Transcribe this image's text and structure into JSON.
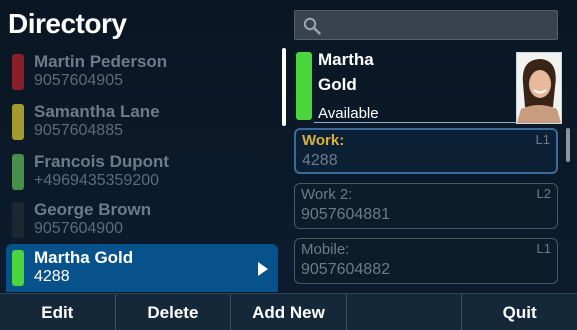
{
  "header": {
    "title": "Directory",
    "search_placeholder": ""
  },
  "contacts": [
    {
      "name": "Martin Pederson",
      "number": "9057604905",
      "status_color": "#8a1f2a"
    },
    {
      "name": "Samantha Lane",
      "number": "9057604885",
      "status_color": "#a29a2b"
    },
    {
      "name": "Francois Dupont",
      "number": "+4969435359200",
      "status_color": "#4a8f49"
    },
    {
      "name": "George Brown",
      "number": "9057604900",
      "status_color": "#1c2731"
    },
    {
      "name": "Martha Gold",
      "number": "4288",
      "status_color": "#4cd63d",
      "selected": true
    }
  ],
  "detail": {
    "first_name": "Martha",
    "last_name": "Gold",
    "status": "Available",
    "fields": [
      {
        "label": "Work:",
        "value": "4288",
        "line": "L1",
        "active": true
      },
      {
        "label": "Work 2:",
        "value": "9057604881",
        "line": "L2",
        "active": false
      },
      {
        "label": "Mobile:",
        "value": "9057604882",
        "line": "L1",
        "active": false
      }
    ]
  },
  "softkeys": [
    "Edit",
    "Delete",
    "Add New",
    "",
    "Quit"
  ],
  "colors": {
    "accent": "#08528c",
    "available": "#4cd63d",
    "work_label": "#d7b13b"
  }
}
